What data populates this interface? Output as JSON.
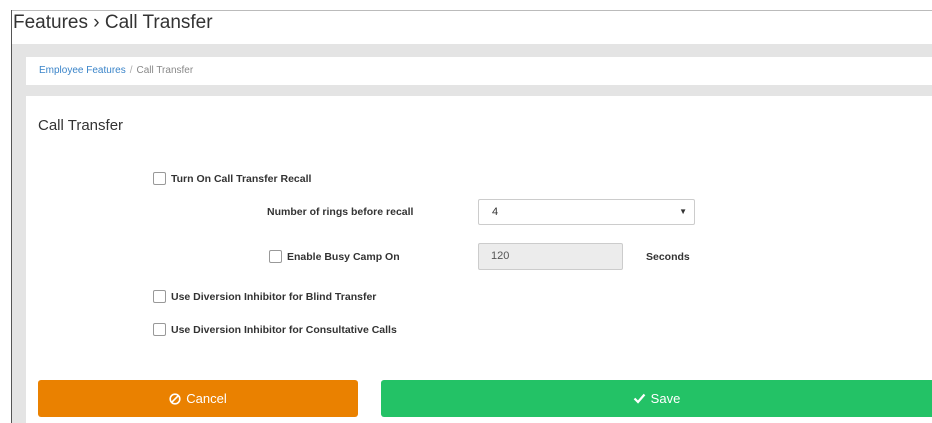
{
  "header": {
    "title": "Features › Call Transfer"
  },
  "breadcrumb": {
    "parent": "Employee Features",
    "separator": "/",
    "current": "Call Transfer"
  },
  "panel": {
    "title": "Call Transfer"
  },
  "form": {
    "recall_checkbox_label": "Turn On Call Transfer Recall",
    "rings_label": "Number of rings before recall",
    "rings_value": "4",
    "busy_camp_checkbox_label": "Enable Busy Camp On",
    "busy_camp_value": "120",
    "busy_camp_unit": "Seconds",
    "blind_transfer_label": "Use Diversion Inhibitor for Blind Transfer",
    "consultative_label": "Use Diversion Inhibitor for Consultative Calls"
  },
  "actions": {
    "cancel_label": "Cancel",
    "save_label": "Save"
  },
  "colors": {
    "cancel": "#ea8100",
    "save": "#23c266",
    "link": "#3a84c9"
  },
  "icons": {
    "cancel": "ban-icon",
    "save": "check-icon",
    "dropdown": "caret-down-icon"
  }
}
